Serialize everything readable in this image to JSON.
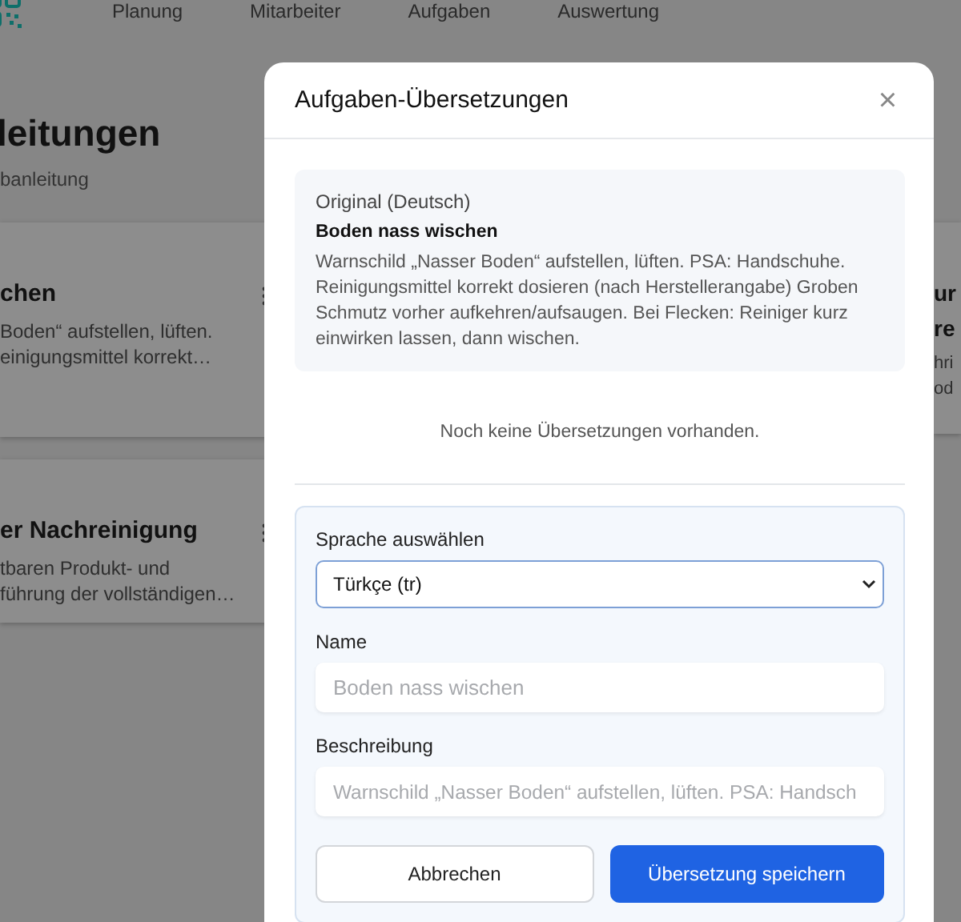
{
  "nav": [
    {
      "label": "Planung"
    },
    {
      "label": "Mitarbeiter"
    },
    {
      "label": "Aufgaben"
    },
    {
      "label": "Auswertung"
    }
  ],
  "page": {
    "title": "leitungen",
    "subtitle": "banleitung"
  },
  "cards_left": [
    {
      "title": "chen",
      "lines": [
        "Boden“ aufstellen, lüften.",
        "einigungsmittel korrekt…"
      ]
    },
    {
      "title": "er Nachreinigung",
      "lines": [
        "tbaren Produkt- und",
        "führung der vollständigen…"
      ]
    }
  ],
  "cards_right": [
    {
      "title_lines": [
        "ur",
        "re"
      ],
      "lines": [
        "hri",
        "od"
      ]
    }
  ],
  "dialog": {
    "title": "Aufgaben-Übersetzungen",
    "close": "×",
    "original": {
      "label": "Original (Deutsch)",
      "name": "Boden nass wischen",
      "description": "Warnschild „Nasser Boden“ aufstellen, lüften. PSA: Handschuhe. Reinigungsmittel korrekt dosieren (nach Herstellerangabe) Groben Schmutz vorher aufkehren/aufsaugen. Bei Flecken: Reiniger kurz einwirken lassen, dann wischen."
    },
    "empty_text": "Noch keine Übersetzungen vorhanden.",
    "form": {
      "language_label": "Sprache auswählen",
      "language_value": "Türkçe (tr)",
      "name_label": "Name",
      "name_placeholder": "Boden nass wischen",
      "description_label": "Beschreibung",
      "description_placeholder": "Warnschild „Nasser Boden“ aufstellen, lüften. PSA: Handsch",
      "cancel": "Abbrechen",
      "save": "Übersetzung speichern"
    }
  }
}
